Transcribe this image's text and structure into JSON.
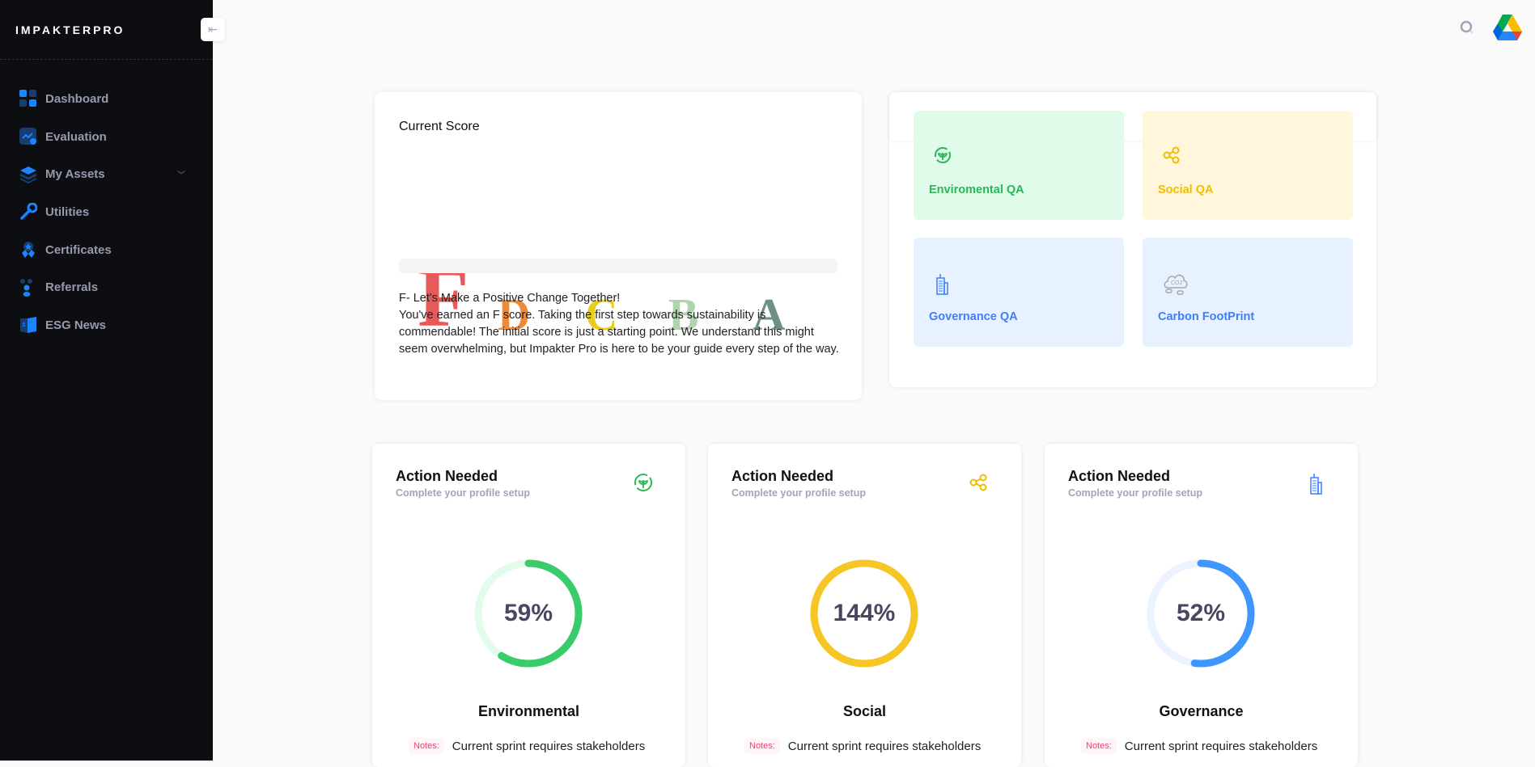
{
  "sidebar": {
    "logo": "IMPAKTERPRO",
    "items": [
      {
        "label": "Dashboard",
        "icon": "dashboard-icon"
      },
      {
        "label": "Evaluation",
        "icon": "evaluation-icon"
      },
      {
        "label": "My Assets",
        "icon": "layers-icon",
        "expandable": true
      },
      {
        "label": "Utilities",
        "icon": "wrench-icon"
      },
      {
        "label": "Certificates",
        "icon": "award-icon"
      },
      {
        "label": "Referrals",
        "icon": "people-icon"
      },
      {
        "label": "ESG News",
        "icon": "book-icon"
      }
    ]
  },
  "score": {
    "title": "Current Score",
    "grades": [
      "F",
      "D",
      "C",
      "B",
      "A"
    ],
    "grade_colors": [
      "#e85a5a",
      "#ef8a37",
      "#e8cd1f",
      "#b1d3ae",
      "#6e9080"
    ],
    "current": "F",
    "headline": "F- Let's Make a Positive Change Together!",
    "body": "You've earned an F score. Taking the first step towards sustainability is commendable! The initial score is just a starting point. We understand this might seem overwhelming, but Impakter Pro is here to be your guide every step of the way."
  },
  "qa": [
    {
      "label": "Enviromental QA",
      "icon": "plant-icon",
      "bg": "#e0fbe9",
      "color": "#29b856"
    },
    {
      "label": "Social QA",
      "icon": "share-icon",
      "bg": "#fff6dc",
      "color": "#f1bc00"
    },
    {
      "label": "Governance QA",
      "icon": "building-icon",
      "bg": "#e8f1ff",
      "color": "#3e7ef7"
    },
    {
      "label": "Carbon FootPrint",
      "icon": "co2-cloud-icon",
      "bg": "#e8f1ff",
      "color": "#3e7ef7"
    }
  ],
  "actions": [
    {
      "title": "Action Needed",
      "subtitle": "Complete your profile setup",
      "percent": 59,
      "percent_label": "59%",
      "category": "Environmental",
      "color": "#38cc6a",
      "track": "#e3fbea",
      "notes_label": "Notes:",
      "notes": "Current sprint requires stakeholders"
    },
    {
      "title": "Action Needed",
      "subtitle": "Complete your profile setup",
      "percent": 144,
      "percent_label": "144%",
      "category": "Social",
      "color": "#f6c526",
      "track": "#fff6dc",
      "notes_label": "Notes:",
      "notes": "Current sprint requires stakeholders"
    },
    {
      "title": "Action Needed",
      "subtitle": "Complete your profile setup",
      "percent": 52,
      "percent_label": "52%",
      "category": "Governance",
      "color": "#3e97ff",
      "track": "#eaf3ff",
      "notes_label": "Notes:",
      "notes": "Current sprint requires stakeholders"
    }
  ]
}
